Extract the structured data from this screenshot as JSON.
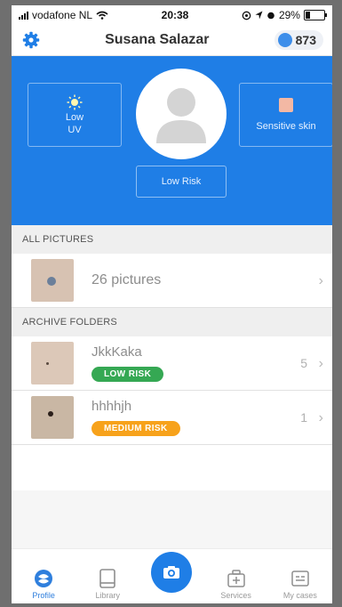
{
  "status": {
    "carrier": "vodafone NL",
    "time": "20:38",
    "battery": "29%"
  },
  "header": {
    "title": "Susana Salazar",
    "points": "873"
  },
  "profile": {
    "uv_line1": "Low",
    "uv_line2": "UV",
    "skin_label": "Sensitive skin",
    "risk_label": "Low Risk"
  },
  "all_pictures": {
    "section_label": "ALL PICTURES",
    "count_label": "26 pictures"
  },
  "archive": {
    "section_label": "ARCHIVE FOLDERS",
    "folders": [
      {
        "name": "JkkKaka",
        "badge": "LOW RISK",
        "count": "5"
      },
      {
        "name": "hhhhjh",
        "badge": "MEDIUM RISK",
        "count": "1"
      }
    ]
  },
  "tabs": [
    {
      "label": "Profile",
      "icon": "profile-icon"
    },
    {
      "label": "Library",
      "icon": "library-icon"
    },
    {
      "label": "",
      "icon": "camera-icon"
    },
    {
      "label": "Services",
      "icon": "services-icon"
    },
    {
      "label": "My cases",
      "icon": "cases-icon"
    }
  ],
  "colors": {
    "brand_blue": "#1f7ee6",
    "low_risk": "#35a853",
    "medium_risk": "#f7a21b"
  }
}
